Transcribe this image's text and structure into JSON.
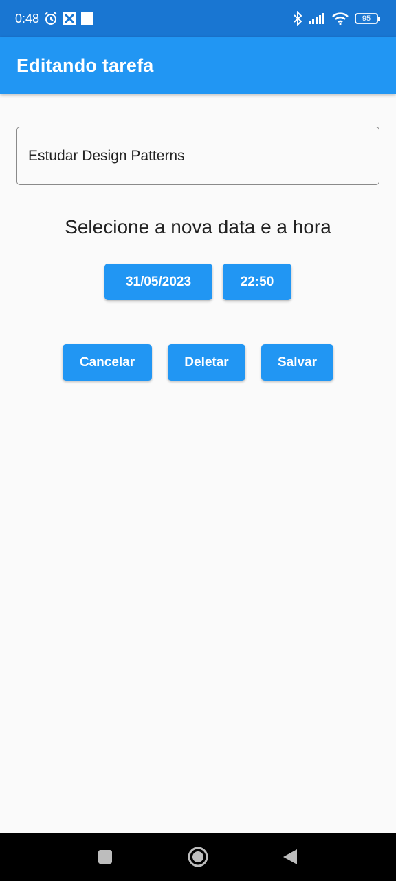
{
  "status_bar": {
    "time": "0:48",
    "battery": "95",
    "icons": [
      "alarm-icon",
      "photos-icon",
      "notification-square-icon",
      "bluetooth-icon",
      "signal-icon",
      "wifi-icon",
      "battery-icon"
    ]
  },
  "app_bar": {
    "title": "Editando tarefa"
  },
  "task_field": {
    "value": "Estudar Design Patterns"
  },
  "prompt": "Selecione a nova data e a hora",
  "date_button": "31/05/2023",
  "time_button": "22:50",
  "actions": {
    "cancel": "Cancelar",
    "delete": "Deletar",
    "save": "Salvar"
  },
  "nav_bar": {
    "icons": [
      "recents-icon",
      "home-icon",
      "back-icon"
    ]
  },
  "colors": {
    "primary": "#2196f3",
    "status_bar": "#1976d2",
    "background": "#fafafa",
    "nav_bar": "#000000"
  }
}
